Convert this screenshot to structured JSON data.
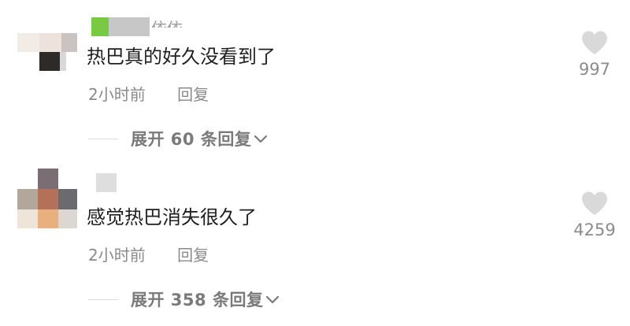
{
  "comments": [
    {
      "username": "依依",
      "text": "热巴真的好久没看到了",
      "time": "2小时前",
      "reply_label": "回复",
      "expand_label": "展开 60 条回复",
      "like_count": "997"
    },
    {
      "username": "",
      "text": "感觉热巴消失很久了",
      "time": "2小时前",
      "reply_label": "回复",
      "expand_label": "展开 358 条回复",
      "like_count": "4259"
    }
  ],
  "colors": {
    "text": "#1f1f1f",
    "meta": "#8a8a8a",
    "heart": "#d9d9d9"
  },
  "icons": {
    "like": "heart-icon",
    "expand": "chevron-down-icon"
  }
}
